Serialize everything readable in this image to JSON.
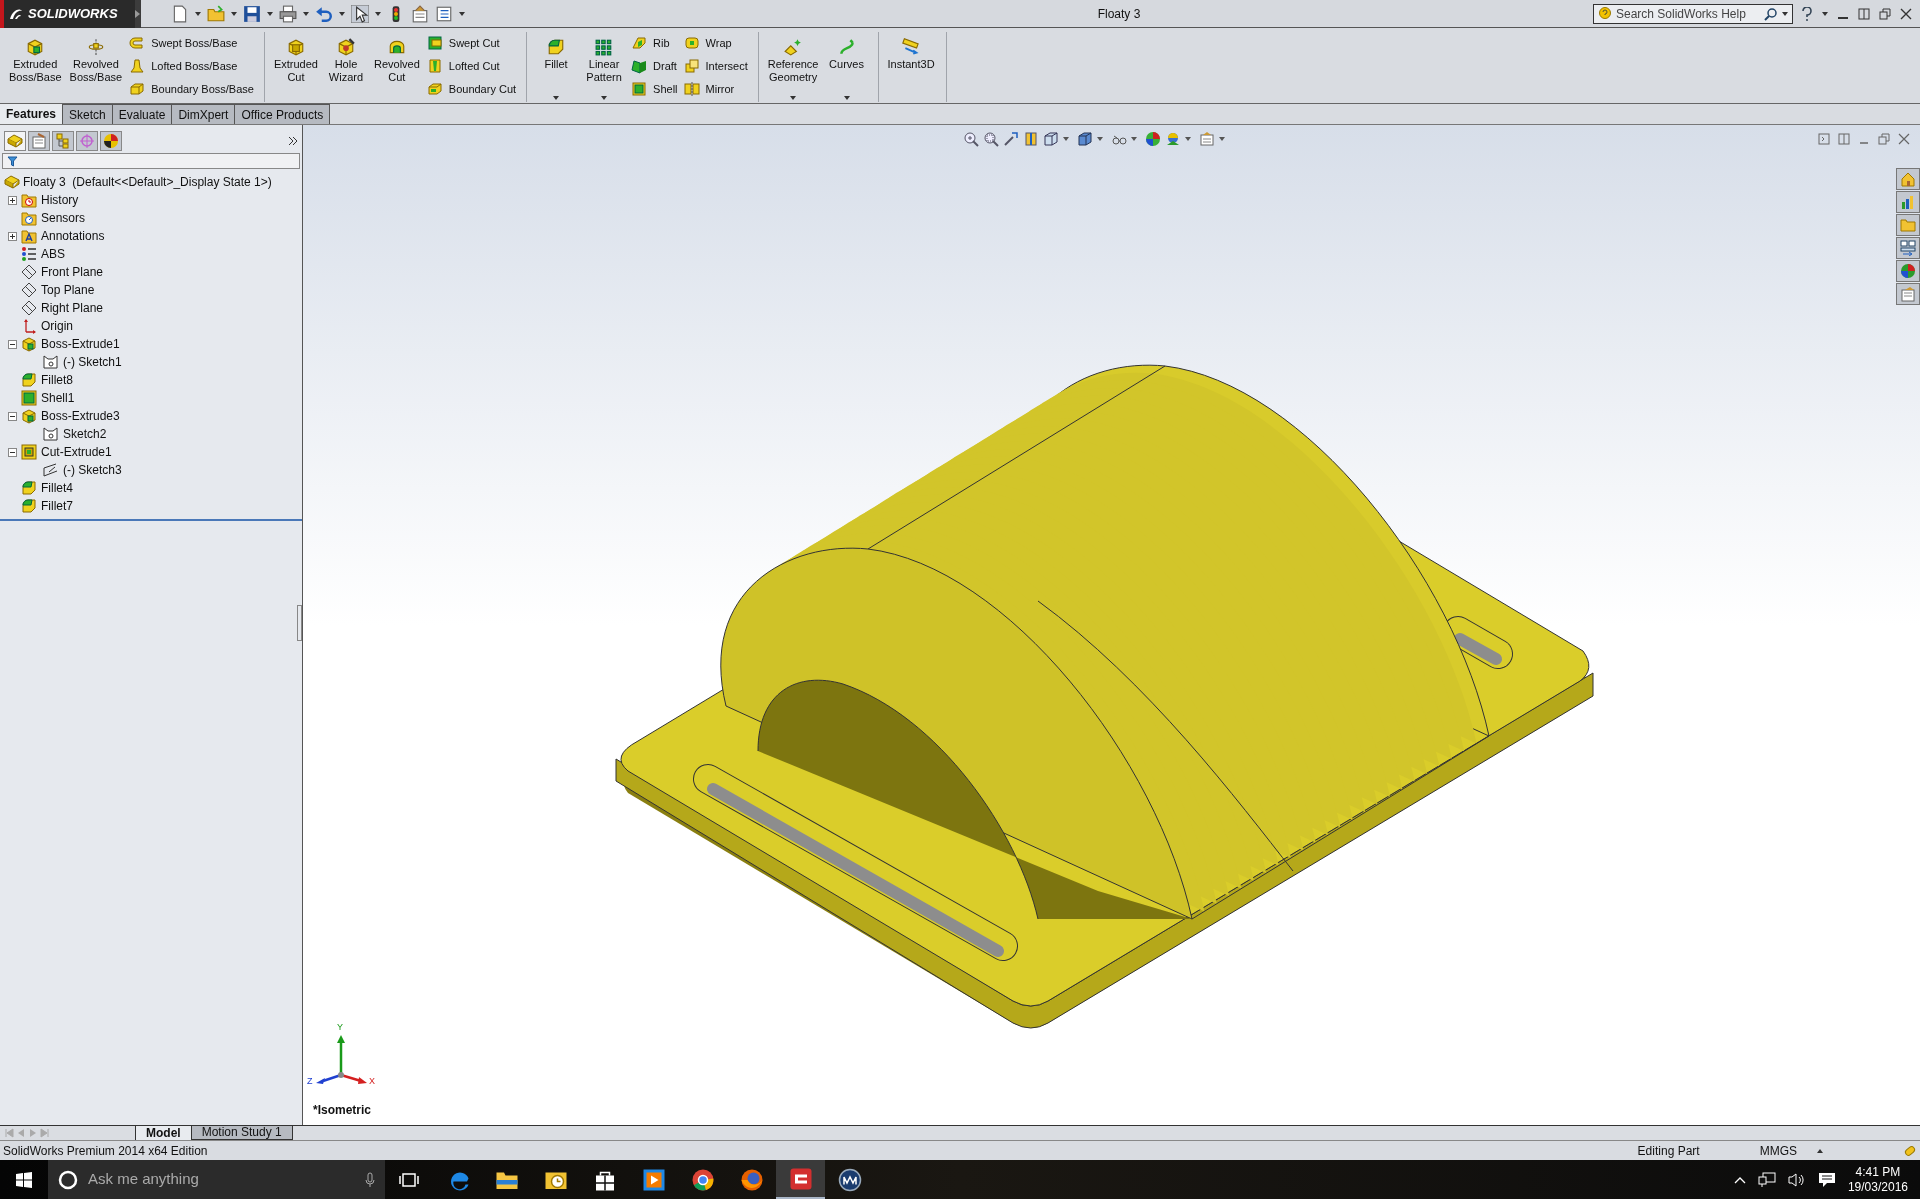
{
  "window": {
    "logo": "SOLIDWORKS",
    "title": "Floaty 3",
    "search_placeholder": "Search SolidWorks Help"
  },
  "command_manager": [
    {
      "items": [
        {
          "kind": "large",
          "lines": [
            "Extruded",
            "Boss/Base"
          ],
          "dropdown": false
        },
        {
          "kind": "large",
          "lines": [
            "Revolved",
            "Boss/Base"
          ],
          "dropdown": false
        },
        {
          "kind": "stack",
          "items": [
            "Swept Boss/Base",
            "Lofted Boss/Base",
            "Boundary Boss/Base"
          ]
        }
      ]
    },
    {
      "items": [
        {
          "kind": "large",
          "lines": [
            "Extruded",
            "Cut"
          ],
          "dropdown": false
        },
        {
          "kind": "large",
          "lines": [
            "Hole",
            "Wizard"
          ],
          "dropdown": false
        },
        {
          "kind": "large",
          "lines": [
            "Revolved",
            "Cut"
          ],
          "dropdown": false
        },
        {
          "kind": "stack",
          "items": [
            "Swept Cut",
            "Lofted Cut",
            "Boundary Cut"
          ]
        }
      ]
    },
    {
      "items": [
        {
          "kind": "large",
          "lines": [
            "Fillet"
          ],
          "dropdown": true
        },
        {
          "kind": "large",
          "lines": [
            "Linear",
            "Pattern"
          ],
          "dropdown": true
        },
        {
          "kind": "stack",
          "items": [
            "Rib",
            "Draft",
            "Shell"
          ]
        },
        {
          "kind": "stack",
          "items": [
            "Wrap",
            "Intersect",
            "Mirror"
          ]
        }
      ]
    },
    {
      "items": [
        {
          "kind": "large",
          "lines": [
            "Reference",
            "Geometry"
          ],
          "dropdown": true
        },
        {
          "kind": "large",
          "lines": [
            "Curves"
          ],
          "dropdown": true
        }
      ]
    },
    {
      "items": [
        {
          "kind": "large",
          "lines": [
            "Instant3D"
          ],
          "dropdown": false
        }
      ]
    }
  ],
  "tabs": [
    {
      "label": "Features",
      "selected": true
    },
    {
      "label": "Sketch",
      "selected": false
    },
    {
      "label": "Evaluate",
      "selected": false
    },
    {
      "label": "DimXpert",
      "selected": false
    },
    {
      "label": "Office Products",
      "selected": false
    }
  ],
  "panel_tabs": [
    {
      "selected": true
    },
    {
      "selected": false
    },
    {
      "selected": false
    },
    {
      "selected": false
    },
    {
      "selected": false
    }
  ],
  "feature_tree": {
    "root": "Floaty 3  (Default<<Default>_Display State 1>)",
    "items": [
      {
        "label": "History",
        "kind": "history",
        "expanded": false
      },
      {
        "label": "Sensors",
        "kind": "sensor"
      },
      {
        "label": "Annotations",
        "kind": "annotation",
        "expanded": false
      },
      {
        "label": "ABS",
        "kind": "material"
      },
      {
        "label": "Front Plane",
        "kind": "plane"
      },
      {
        "label": "Top Plane",
        "kind": "plane"
      },
      {
        "label": "Right Plane",
        "kind": "plane"
      },
      {
        "label": "Origin",
        "kind": "origin"
      },
      {
        "label": "Boss-Extrude1",
        "kind": "extrude",
        "expanded": true,
        "children": [
          {
            "label": "(-) Sketch1",
            "kind": "sketch"
          }
        ]
      },
      {
        "label": "Fillet8",
        "kind": "fillet"
      },
      {
        "label": "Shell1",
        "kind": "shell"
      },
      {
        "label": "Boss-Extrude3",
        "kind": "extrude",
        "expanded": true,
        "children": [
          {
            "label": "Sketch2",
            "kind": "sketch"
          }
        ]
      },
      {
        "label": "Cut-Extrude1",
        "kind": "cut",
        "expanded": true,
        "children": [
          {
            "label": "(-) Sketch3",
            "kind": "sketch3d"
          }
        ]
      },
      {
        "label": "Fillet4",
        "kind": "fillet"
      },
      {
        "label": "Fillet7",
        "kind": "fillet"
      }
    ]
  },
  "viewport": {
    "view_label": "*Isometric",
    "triad": {
      "x": "X",
      "y": "Y",
      "z": "Z"
    }
  },
  "bottom_tabs": [
    {
      "label": "Model",
      "selected": true
    },
    {
      "label": "Motion Study 1",
      "selected": false
    }
  ],
  "status_bar": {
    "edition": "SolidWorks Premium 2014 x64 Edition",
    "mode": "Editing Part",
    "units": "MMGS"
  },
  "taskbar": {
    "search_placeholder": "Ask me anything",
    "apps": [
      {
        "kind": "edge",
        "active": false
      },
      {
        "kind": "explorer",
        "active": false
      },
      {
        "kind": "mail",
        "active": false
      },
      {
        "kind": "store",
        "active": false
      },
      {
        "kind": "media",
        "active": false
      },
      {
        "kind": "chrome",
        "active": false
      },
      {
        "kind": "firefox",
        "active": false
      },
      {
        "kind": "cad",
        "active": true
      },
      {
        "kind": "globe",
        "active": false
      }
    ],
    "time": "4:41 PM",
    "date": "19/03/2016"
  }
}
